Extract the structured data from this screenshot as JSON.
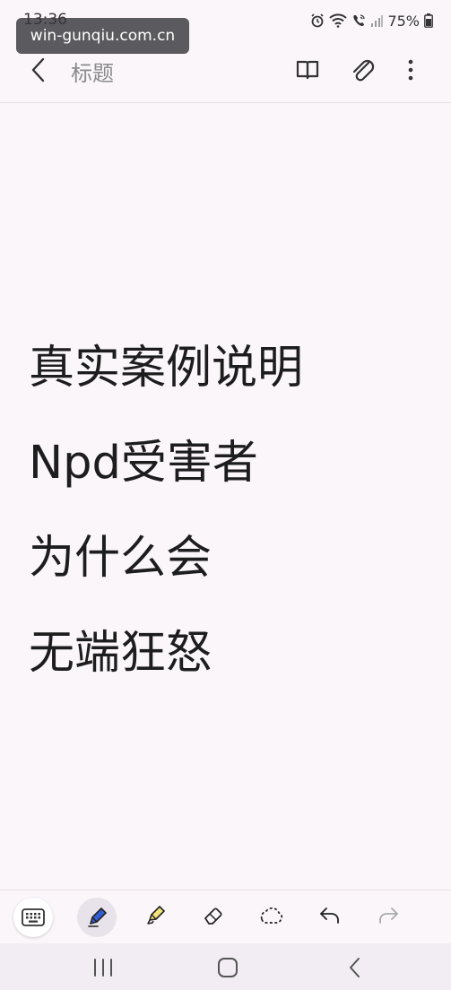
{
  "status_bar": {
    "time": "13:36",
    "battery": "75%",
    "icons": [
      "alarm-icon",
      "wifi-icon",
      "wifi-calling-icon",
      "signal-icon",
      "battery-icon"
    ]
  },
  "watermark": "win-gunqiu.com.cn",
  "app_bar": {
    "title": "标题",
    "icons": [
      "back-arrow-icon",
      "book-icon",
      "paperclip-icon",
      "more-options-icon"
    ]
  },
  "note": {
    "lines": [
      "真实案例说明",
      "Npd受害者",
      "为什么会",
      "无端狂怒"
    ]
  },
  "toolbar": {
    "tools": [
      "keyboard-icon",
      "pen-icon",
      "highlighter-icon",
      "eraser-icon",
      "lasso-select-icon",
      "undo-icon",
      "redo-icon"
    ],
    "active_tool": "pen"
  },
  "nav_bar": {
    "buttons": [
      "recent-apps-icon",
      "home-icon",
      "back-icon"
    ]
  },
  "colors": {
    "background": "#fbf6fa",
    "pen_accent": "#2f5fd4",
    "highlighter_accent": "#f3e27a"
  }
}
